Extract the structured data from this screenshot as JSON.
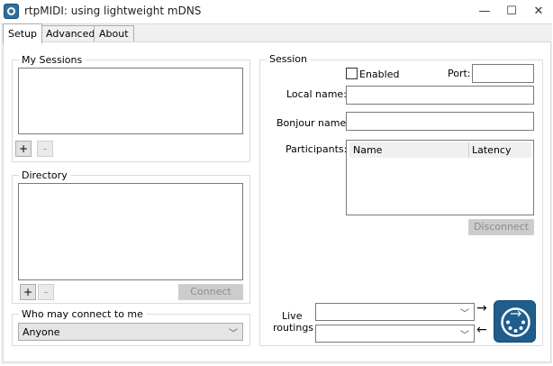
{
  "window": {
    "title": "rtpMIDI: using lightweight mDNS",
    "minimize": "—",
    "maximize": "☐",
    "close": "✕"
  },
  "tabs": [
    {
      "label": "Setup",
      "active": true
    },
    {
      "label": "Advanced",
      "active": false
    },
    {
      "label": "About",
      "active": false
    }
  ],
  "my_sessions": {
    "title": "My Sessions",
    "add": "+",
    "remove": "-"
  },
  "directory": {
    "title": "Directory",
    "add": "+",
    "remove": "-",
    "connect": "Connect"
  },
  "who_may_connect": {
    "title": "Who may connect to me",
    "selected": "Anyone"
  },
  "session": {
    "title": "Session",
    "enabled_label": "Enabled",
    "enabled_checked": false,
    "port_label": "Port:",
    "port_value": "",
    "local_name_label": "Local name:",
    "local_name_value": "",
    "bonjour_name_label": "Bonjour name:",
    "bonjour_name_value": "",
    "participants_label": "Participants:",
    "participants_columns": [
      "Name",
      "Latency"
    ],
    "disconnect": "Disconnect"
  },
  "live_routings": {
    "label_line1": "Live",
    "label_line2": "routings",
    "input_selected": "",
    "output_selected": "",
    "arrow_in": "→",
    "arrow_out": "←"
  }
}
